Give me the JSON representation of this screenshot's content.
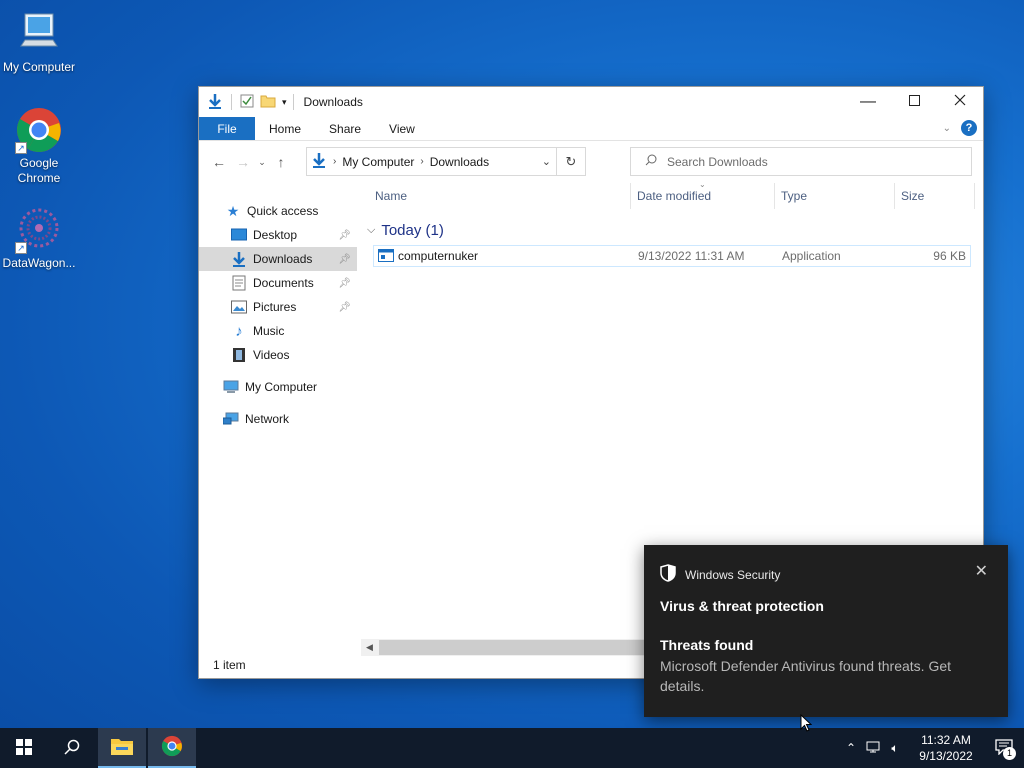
{
  "desktop": {
    "icons": [
      {
        "label": "My Computer",
        "icon": "computer-icon"
      },
      {
        "label": "Google Chrome",
        "icon": "chrome-icon"
      },
      {
        "label": "DataWagon...",
        "icon": "datawagon-icon"
      }
    ]
  },
  "window": {
    "title": "Downloads",
    "ribbon_tabs": [
      "File",
      "Home",
      "Share",
      "View"
    ],
    "help_label": "?",
    "address": {
      "crumbs": [
        "My Computer",
        "Downloads"
      ]
    },
    "search_placeholder": "Search Downloads",
    "nav_pane": {
      "quick_access": "Quick access",
      "items": [
        {
          "label": "Desktop",
          "pinned": true
        },
        {
          "label": "Downloads",
          "pinned": true,
          "selected": true
        },
        {
          "label": "Documents",
          "pinned": true
        },
        {
          "label": "Pictures",
          "pinned": true
        },
        {
          "label": "Music",
          "pinned": false
        },
        {
          "label": "Videos",
          "pinned": false
        }
      ],
      "my_computer": "My Computer",
      "network": "Network"
    },
    "columns": [
      "Name",
      "Date modified",
      "Type",
      "Size"
    ],
    "group_label": "Today (1)",
    "files": [
      {
        "name": "computernuker",
        "date": "9/13/2022 11:31 AM",
        "type": "Application",
        "size": "96 KB"
      }
    ],
    "status": "1 item"
  },
  "toast": {
    "app": "Windows Security",
    "title": "Virus & threat protection",
    "heading": "Threats found",
    "body": "Microsoft Defender Antivirus found threats. Get details."
  },
  "taskbar": {
    "time": "11:32 AM",
    "date": "9/13/2022",
    "notification_count": "1"
  },
  "colors": {
    "accent": "#1a6fc2",
    "taskbar": "#101b2b",
    "toast": "#1f1f1f"
  }
}
